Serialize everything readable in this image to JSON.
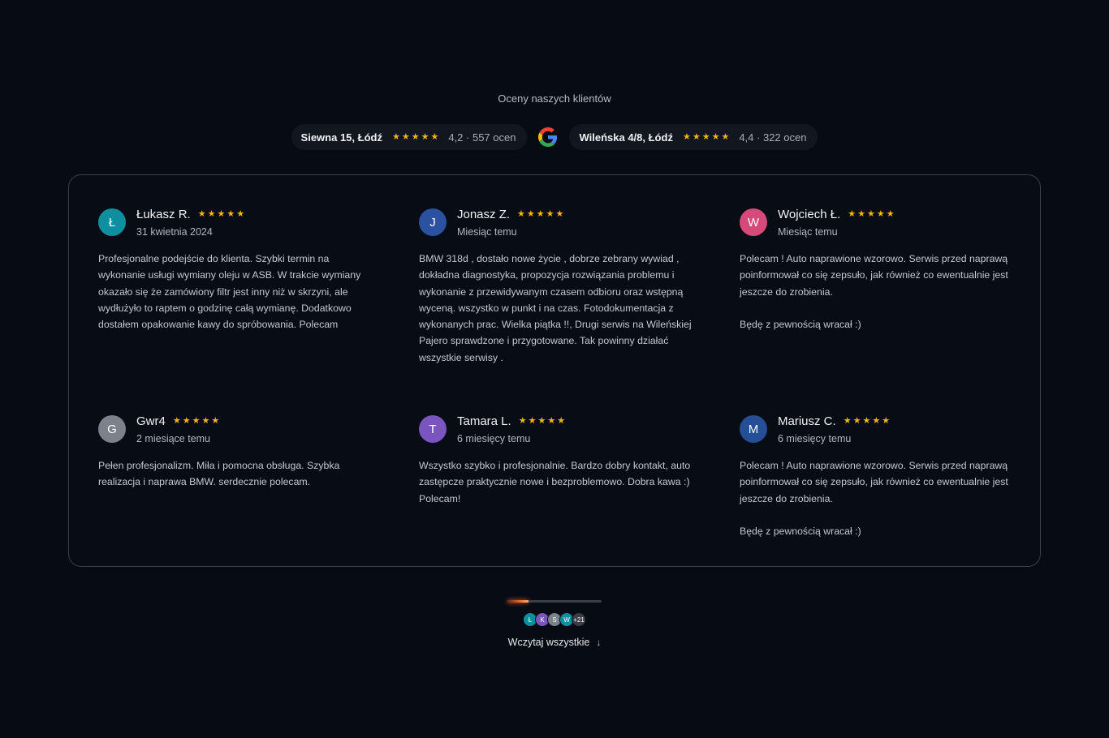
{
  "heading": "Oceny naszych klientów",
  "locations": [
    {
      "name": "Siewna 15, Łódź",
      "score": "4,2 · 557 ocen",
      "stars": 5
    },
    {
      "name": "Wileńska 4/8, Łódź",
      "score": "4,4 · 322 ocen",
      "stars": 5
    }
  ],
  "google_icon": "google-logo-icon",
  "reviews": [
    {
      "initial": "Ł",
      "name": "Łukasz R.",
      "date": "31 kwietnia 2024",
      "color": "#0e8fa0",
      "text": "Profesjonalne podejście do klienta. Szybki termin na wykonanie usługi wymiany oleju w ASB. W trakcie wymiany okazało się że zamówiony filtr jest inny niż w skrzyni, ale wydłużyło to raptem o godzinę całą wymianę. Dodatkowo dostałem opakowanie kawy do spróbowania. Polecam"
    },
    {
      "initial": "J",
      "name": "Jonasz Z.",
      "date": "Miesiąc temu",
      "color": "#2a52a0",
      "text": "BMW 318d , dostało nowe życie , dobrze zebrany wywiad , dokładna diagnostyka, propozycja rozwiązania problemu i wykonanie z przewidywanym czasem odbioru oraz wstępną wyceną. wszystko w punkt i na czas. Fotodokumentacja z wykonanych prac. Wielka piątka !!, Drugi serwis na Wileńskiej Pajero sprawdzone i przygotowane. Tak powinny działać wszystkie serwisy ."
    },
    {
      "initial": "W",
      "name": "Wojciech Ł.",
      "date": "Miesiąc temu",
      "color": "#d64a7a",
      "text": "Polecam ! Auto naprawione wzorowo. Serwis przed naprawą poinformował co się zepsuło, jak również co ewentualnie jest jeszcze do zrobienia.\n\nBędę z pewnością wracał :)"
    },
    {
      "initial": "G",
      "name": "Gwr4",
      "date": "2 miesiące temu",
      "color": "#7c828c",
      "text": "Pełen profesjonalizm. Miła i pomocna obsługa. Szybka realizacja i naprawa BMW. serdecznie polecam."
    },
    {
      "initial": "T",
      "name": "Tamara L.",
      "date": "6 miesięcy temu",
      "color": "#7a55c0",
      "text": "Wszystko szybko i profesjonalnie. Bardzo dobry kontakt, auto zastępcze praktycznie nowe i bezproblemowo. Dobra kawa :) Polecam!"
    },
    {
      "initial": "M",
      "name": "Mariusz C.",
      "date": "6 miesięcy temu",
      "color": "#254e96",
      "text": "Polecam ! Auto naprawione wzorowo. Serwis przed naprawą poinformował co się zepsuło, jak również co ewentualnie jest jeszcze do zrobienia.\n\nBędę z pewnością wracał :)"
    }
  ],
  "progress": 0.22,
  "mini_avatars": [
    {
      "label": "Ł",
      "color": "#0e8fa0"
    },
    {
      "label": "K",
      "color": "#7a55c0"
    },
    {
      "label": "S",
      "color": "#7c828c"
    },
    {
      "label": "W",
      "color": "#0e8fa0"
    },
    {
      "label": "+21",
      "color": "#3a3d44"
    }
  ],
  "load_all_label": "Wczytaj wszystkie",
  "load_all_icon": "arrow-down-icon"
}
